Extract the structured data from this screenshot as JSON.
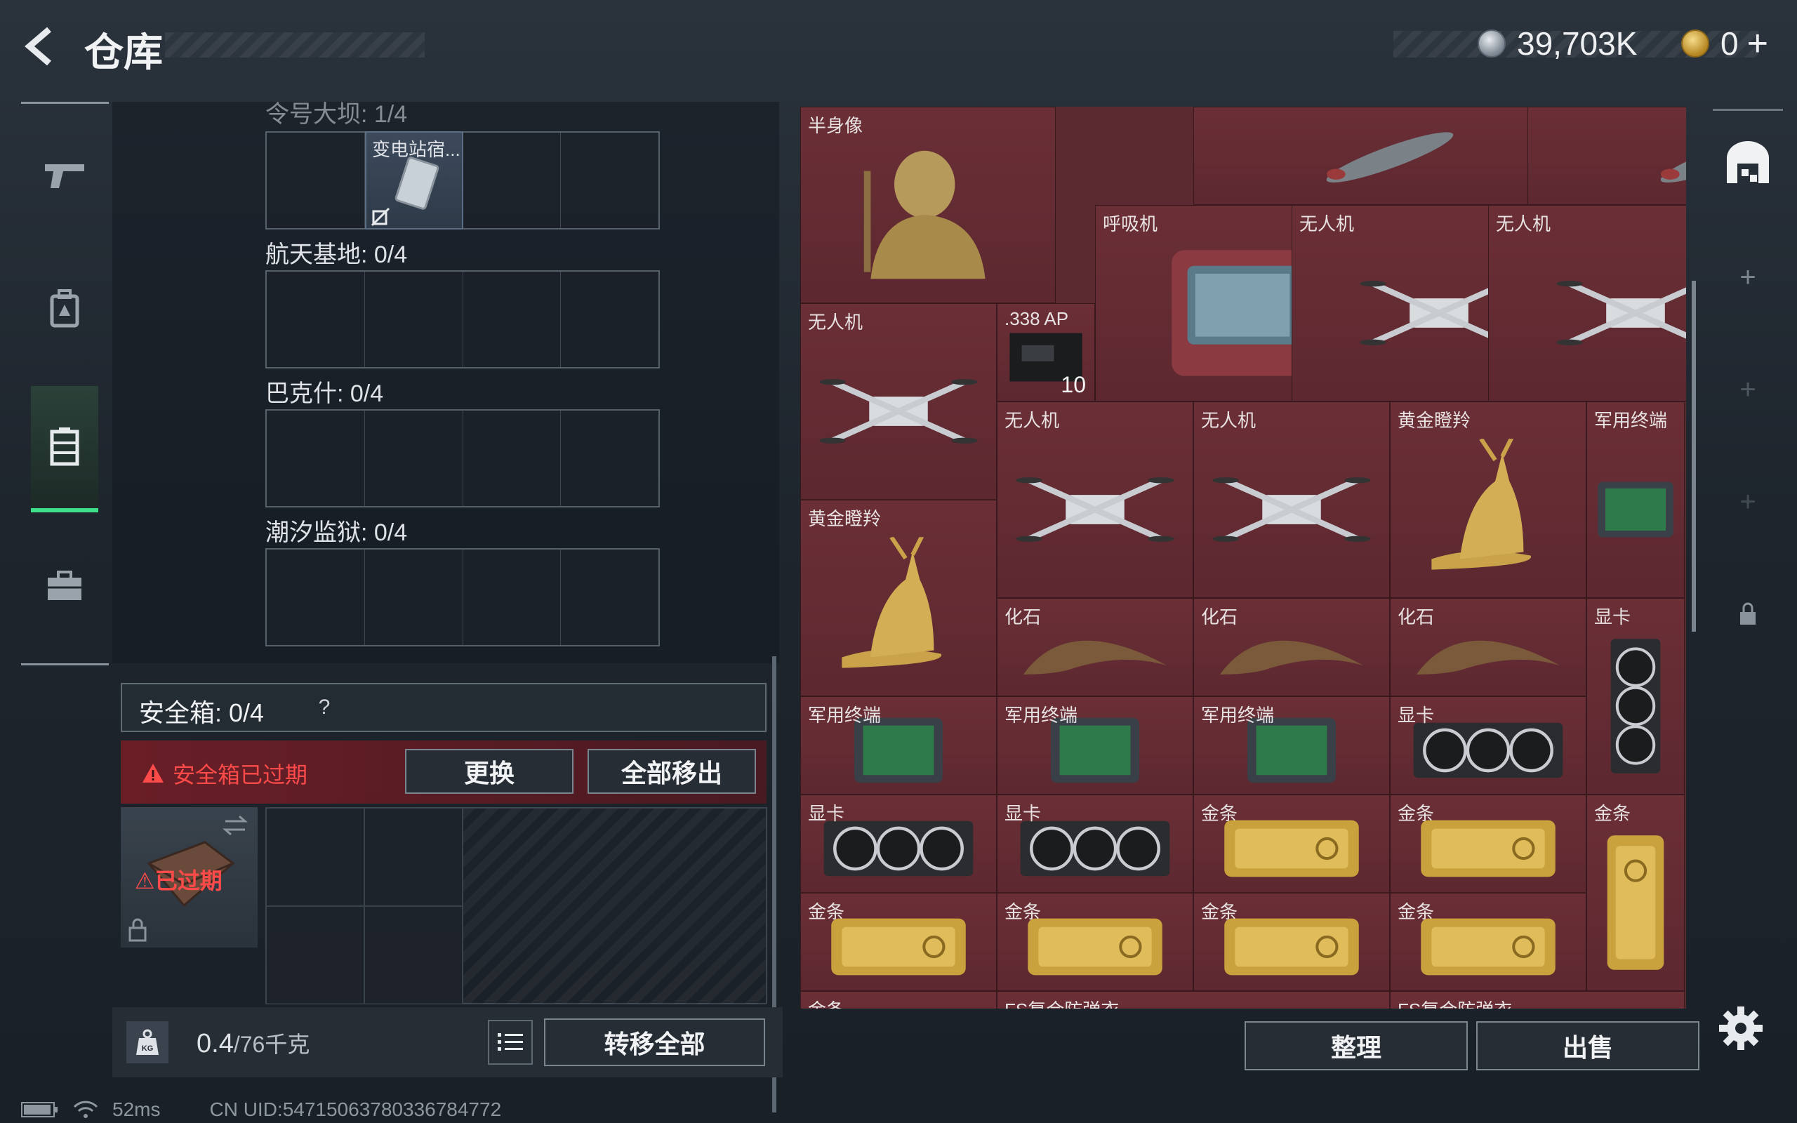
{
  "header": {
    "title": "仓库",
    "silver_amount": "39,703K",
    "gold_amount": "0"
  },
  "left": {
    "categories": [
      {
        "label": "令号大坝: 1/4"
      },
      {
        "label": "航天基地: 0/4"
      },
      {
        "label": "巴克什: 0/4"
      },
      {
        "label": "潮汐监狱: 0/4"
      }
    ],
    "slot_item_label": "变电站宿...",
    "safebox_label": "安全箱: 0/4",
    "safebox_help": "?",
    "expired_notice": "安全箱已过期",
    "replace_button": "更换",
    "remove_all_button": "全部移出",
    "safebox_expired_tag": "已过期",
    "weight_value": "0.4",
    "weight_capacity": "/76千克",
    "weight_tag": "KG",
    "transfer_all_button": "转移全部"
  },
  "stash": {
    "items": [
      {
        "id": "bust",
        "label": "半身像",
        "art": "bust"
      },
      {
        "id": "bomb1",
        "label": "",
        "art": "bomb"
      },
      {
        "id": "bomb2",
        "label": "",
        "art": "bomb"
      },
      {
        "id": "resp",
        "label": "呼吸机",
        "art": "respirator"
      },
      {
        "id": "drone1",
        "label": "无人机",
        "art": "drone"
      },
      {
        "id": "drone2",
        "label": "无人机",
        "art": "drone"
      },
      {
        "id": "drone3",
        "label": "无人机",
        "art": "drone"
      },
      {
        "id": "ammo",
        "label": ".338 AP",
        "count": "10",
        "art": "ammo"
      },
      {
        "id": "drone4",
        "label": "无人机",
        "art": "drone"
      },
      {
        "id": "drone5",
        "label": "无人机",
        "art": "drone"
      },
      {
        "id": "deer1",
        "label": "黄金瞪羚",
        "art": "deer"
      },
      {
        "id": "term1",
        "label": "军用终端",
        "art": "terminal"
      },
      {
        "id": "deer2",
        "label": "黄金瞪羚",
        "art": "deer"
      },
      {
        "id": "fossil1",
        "label": "化石",
        "art": "fossil"
      },
      {
        "id": "fossil2",
        "label": "化石",
        "art": "fossil"
      },
      {
        "id": "fossil3",
        "label": "化石",
        "art": "fossil"
      },
      {
        "id": "gpu1",
        "label": "显卡",
        "art": "gpu-v"
      },
      {
        "id": "term2",
        "label": "军用终端",
        "art": "terminal"
      },
      {
        "id": "term3",
        "label": "军用终端",
        "art": "terminal"
      },
      {
        "id": "term4",
        "label": "军用终端",
        "art": "terminal"
      },
      {
        "id": "gpu2",
        "label": "显卡",
        "art": "gpu"
      },
      {
        "id": "gpu3",
        "label": "显卡",
        "art": "gpu"
      },
      {
        "id": "gpu4",
        "label": "显卡",
        "art": "gpu"
      },
      {
        "id": "gold1",
        "label": "金条",
        "art": "gold"
      },
      {
        "id": "gold2",
        "label": "金条",
        "art": "gold"
      },
      {
        "id": "gold3",
        "label": "金条",
        "art": "gold-v"
      },
      {
        "id": "gold4",
        "label": "金条",
        "art": "gold"
      },
      {
        "id": "gold5",
        "label": "金条",
        "art": "gold"
      },
      {
        "id": "gold6",
        "label": "金条",
        "art": "gold"
      },
      {
        "id": "gold7",
        "label": "金条",
        "art": "gold"
      },
      {
        "id": "gold8",
        "label": "金条",
        "art": "gold"
      },
      {
        "id": "armor1",
        "label": "FS复合防弹衣",
        "art": "none"
      },
      {
        "id": "armor2",
        "label": "FS复合防弹衣",
        "art": "none"
      }
    ]
  },
  "actions": {
    "sort_button": "整理",
    "sell_button": "出售"
  },
  "status": {
    "ping": "52ms",
    "uid": "CN UID:54715063780336784772"
  },
  "colors": {
    "accent_green": "#3fe08a",
    "warning_red": "#ff4a4a",
    "stash_bg": "#5d2830"
  }
}
